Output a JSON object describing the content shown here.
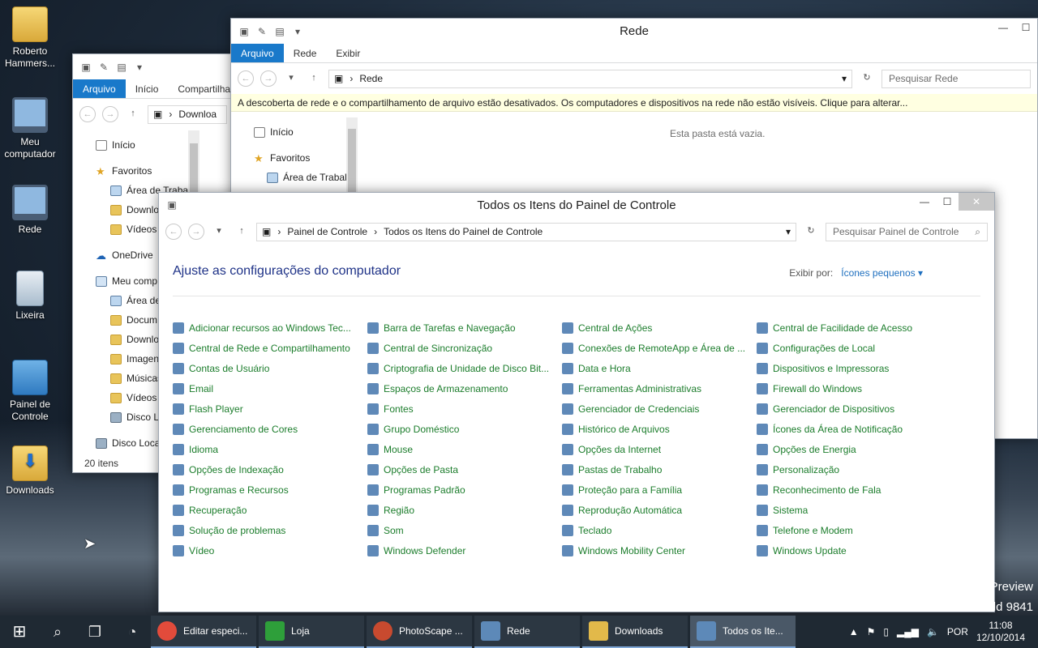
{
  "desktop": {
    "icons": [
      {
        "label": "Roberto Hammers..."
      },
      {
        "label": "Meu computador"
      },
      {
        "label": "Rede"
      },
      {
        "label": "Lixeira"
      },
      {
        "label": "Painel de Controle"
      },
      {
        "label": "Downloads"
      }
    ],
    "watermark": {
      "line1": "Preview",
      "line2": "ld 9841"
    }
  },
  "downloads_window": {
    "ribbon_tabs": [
      "Arquivo",
      "Início",
      "Compartilhar"
    ],
    "address_crumb": "Downloa",
    "tree": [
      "Início",
      "Favoritos",
      "Área de Trabal",
      "Downlo",
      "Vídeos",
      "OneDrive",
      "Meu comp",
      "Área de",
      "Docum",
      "Downlo",
      "Imagen",
      "Músicas",
      "Vídeos",
      "Disco Lo",
      "Disco Loca"
    ],
    "status": "20 itens"
  },
  "rede_window": {
    "title": "Rede",
    "ribbon_tabs": [
      "Arquivo",
      "Rede",
      "Exibir"
    ],
    "address": "Rede",
    "search_placeholder": "Pesquisar Rede",
    "banner": "A descoberta de rede e o compartilhamento de arquivo estão desativados. Os computadores e dispositivos na rede não estão visíveis. Clique para alterar...",
    "tree": [
      "Início",
      "Favoritos",
      "Área de Trabal"
    ],
    "empty_message": "Esta pasta está vazia."
  },
  "control_panel": {
    "title": "Todos os Itens do Painel de Controle",
    "breadcrumb": [
      "Painel de Controle",
      "Todos os Itens do Painel de Controle"
    ],
    "search_placeholder": "Pesquisar Painel de Controle",
    "heading": "Ajuste as configurações do computador",
    "view_by_label": "Exibir por:",
    "view_by_value": "Ícones pequenos ▾",
    "items": [
      "Adicionar recursos ao Windows Tec...",
      "Barra de Tarefas e Navegação",
      "Central de Ações",
      "Central de Facilidade de Acesso",
      "Central de Rede e Compartilhamento",
      "Central de Sincronização",
      "Conexões de RemoteApp e Área de ...",
      "Configurações de Local",
      "Contas de Usuário",
      "Criptografia de Unidade de Disco Bit...",
      "Data e Hora",
      "Dispositivos e Impressoras",
      "Email",
      "Espaços de Armazenamento",
      "Ferramentas Administrativas",
      "Firewall do Windows",
      "Flash Player",
      "Fontes",
      "Gerenciador de Credenciais",
      "Gerenciador de Dispositivos",
      "Gerenciamento de Cores",
      "Grupo Doméstico",
      "Histórico de Arquivos",
      "Ícones da Área de Notificação",
      "Idioma",
      "Mouse",
      "Opções da Internet",
      "Opções de Energia",
      "Opções de Indexação",
      "Opções de Pasta",
      "Pastas de Trabalho",
      "Personalização",
      "Programas e Recursos",
      "Programas Padrão",
      "Proteção para a Família",
      "Reconhecimento de Fala",
      "Recuperação",
      "Região",
      "Reprodução Automática",
      "Sistema",
      "Solução de problemas",
      "Som",
      "Teclado",
      "Telefone e Modem",
      "Vídeo",
      "Windows Defender",
      "Windows Mobility Center",
      "Windows Update"
    ]
  },
  "taskbar": {
    "buttons": [
      {
        "label": "Editar especi...",
        "color": "#e24b3b"
      },
      {
        "label": "Loja",
        "color": "#2e9f3a"
      },
      {
        "label": "PhotoScape ...",
        "color": "#c84a2f"
      },
      {
        "label": "Rede",
        "color": "#5d89b8"
      },
      {
        "label": "Downloads",
        "color": "#e2b94a"
      },
      {
        "label": "Todos os Ite...",
        "color": "#5d89b8"
      }
    ],
    "language": "POR",
    "time": "11:08",
    "date": "12/10/2014"
  }
}
